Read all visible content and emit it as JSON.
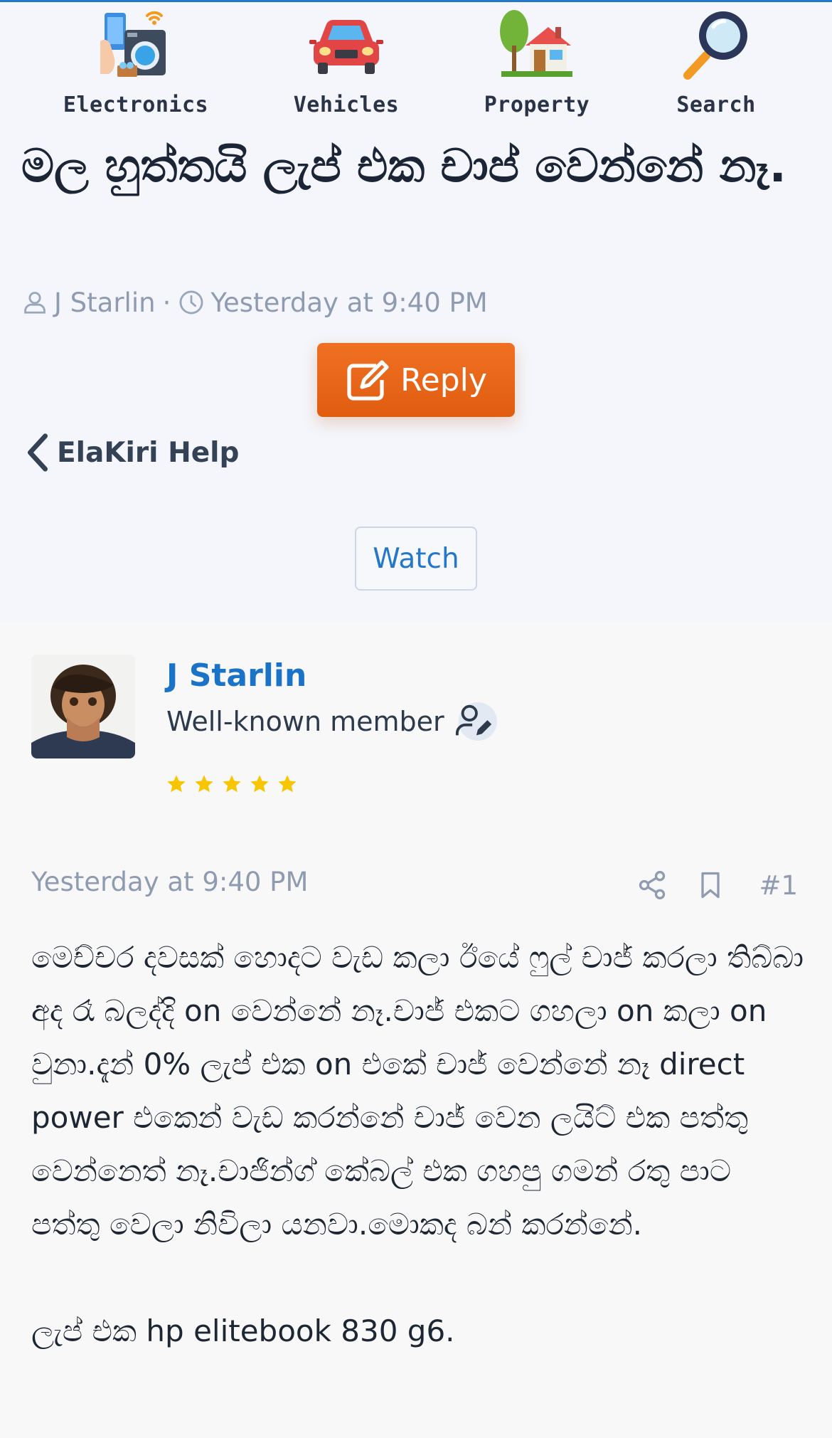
{
  "categories": [
    {
      "label": "Electronics",
      "icon": "electronics-icon"
    },
    {
      "label": "Vehicles",
      "icon": "car-icon"
    },
    {
      "label": "Property",
      "icon": "house-icon"
    },
    {
      "label": "Search",
      "icon": "magnifier-icon"
    }
  ],
  "thread": {
    "title": "මල හුත්තයි ලැප් එක චාප් වෙන්නේ නෑ.",
    "author": "J Starlin",
    "separator": "·",
    "time": "Yesterday at 9:40 PM",
    "reply_label": "Reply",
    "breadcrumb": "ElaKiri Help",
    "watch_label": "Watch"
  },
  "post": {
    "author": "J Starlin",
    "role": "Well-known member",
    "stars": 5,
    "date": "Yesterday at 9:40 PM",
    "number": "#1",
    "paragraphs": [
      "මෙච්චර දවසක් හොදට වැඩ කලා ඊයේ ෆුල් චාජ් කරලා තිබ්බා අද රෑ බලද්දි on වෙන්නේ නෑ.චාජ් එකට ගහලා on කලා on වුනා.දැන් 0% ලැප් එක on එකේ චාජ් වෙන්නේ නෑ direct power එකෙන් වැඩ කරන්නේ චාජ් වෙන ලයිට් එක පත්තු වෙන්නෙත් නෑ.චාජින්ග් කේබල් එක ගහපු ගමන් රතු පාට පත්තු වෙලා නිවිලා යනවා.මොකද බන් කරන්නේ.",
      "ලැප් එක hp elitebook 830 g6."
    ]
  },
  "colors": {
    "accent": "#2577c9",
    "reply_button": "#e8651a",
    "star": "#f7c600",
    "muted": "#8e9bb0"
  }
}
